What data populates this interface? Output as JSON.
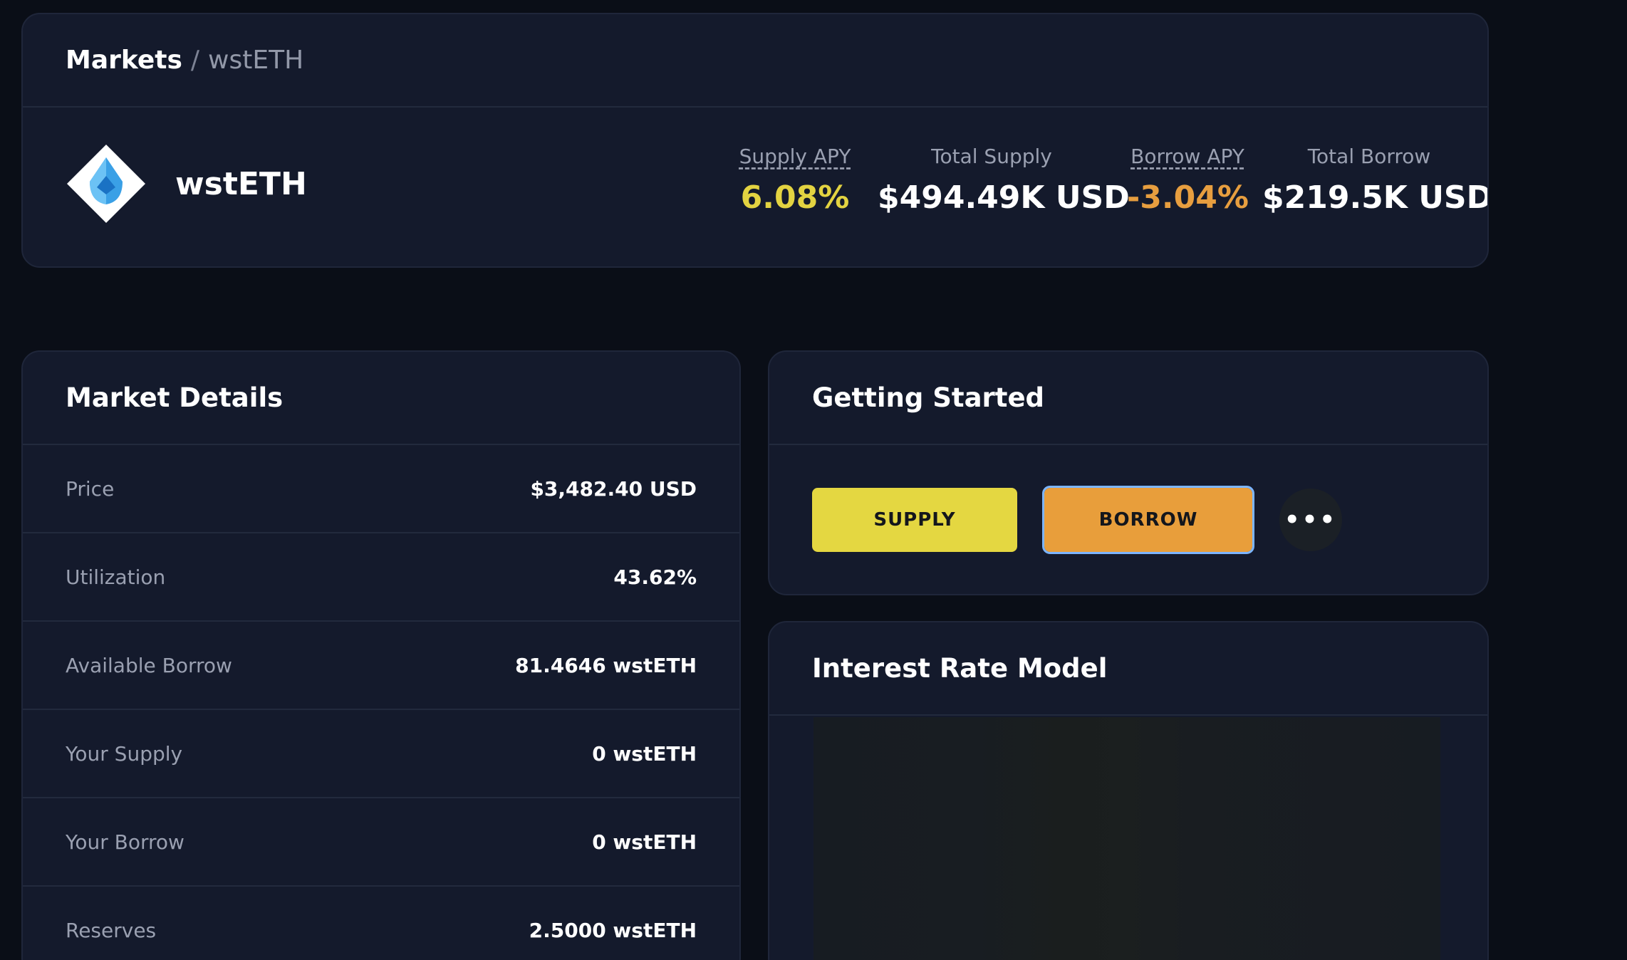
{
  "header": {
    "breadcrumb": {
      "root": "Markets",
      "separator": "/",
      "current": "wstETH"
    },
    "asset": {
      "name": "wstETH",
      "logo_icon": "wsteth-diamond-icon"
    },
    "stats": [
      {
        "label": "Supply APY",
        "value": "6.08%",
        "color": "#e3d341"
      },
      {
        "label": "Total Supply",
        "value": "$494.49K USD",
        "color": "#ffffff"
      },
      {
        "label": "Borrow APY",
        "value": "-3.04%",
        "color": "#e79e3f"
      },
      {
        "label": "Total Borrow",
        "value": "$219.5K USD",
        "color": "#ffffff"
      }
    ]
  },
  "market_details": {
    "title": "Market Details",
    "rows": [
      {
        "label": "Price",
        "value": "$3,482.40 USD"
      },
      {
        "label": "Utilization",
        "value": "43.62%"
      },
      {
        "label": "Available Borrow",
        "value": "81.4646 wstETH"
      },
      {
        "label": "Your Supply",
        "value": "0 wstETH"
      },
      {
        "label": "Your Borrow",
        "value": "0 wstETH"
      },
      {
        "label": "Reserves",
        "value": "2.5000 wstETH"
      }
    ]
  },
  "getting_started": {
    "title": "Getting Started",
    "supply_label": "SUPPLY",
    "borrow_label": "BORROW",
    "more_label": "•••",
    "more_icon": "more-dots-icon"
  },
  "interest_rate_model": {
    "title": "Interest Rate Model"
  },
  "colors": {
    "supply_button": "#e4d741",
    "borrow_button": "#e89e3b",
    "card_background": "#141a2c",
    "page_background": "#0a0e17"
  }
}
